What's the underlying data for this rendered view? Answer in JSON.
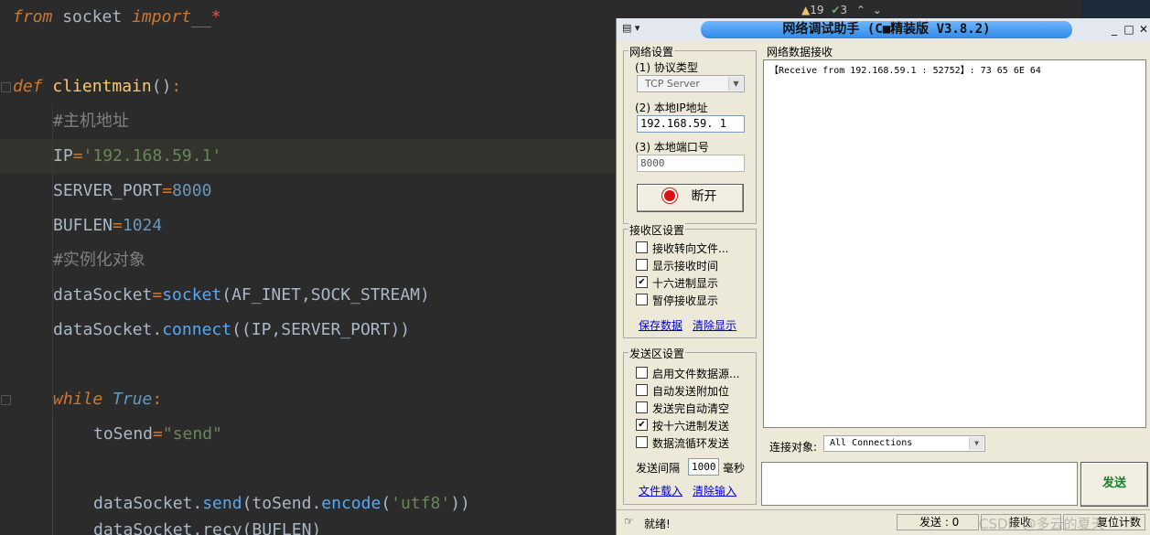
{
  "editor": {
    "line1": {
      "kw1": "from",
      "mid": " socket ",
      "kw2": "import",
      "space": "  ",
      "star": "*"
    },
    "line_def": {
      "kw": "def",
      "name": "clientmain",
      "paren": "()",
      "colon": ":"
    },
    "comment1": "#主机地址",
    "ip_line": {
      "name": "IP",
      "eq": "=",
      "value": "'192.168.59.1'"
    },
    "port_line": {
      "name": "SERVER_PORT",
      "eq": "=",
      "value": "8000"
    },
    "buflen_line": {
      "name": "BUFLEN",
      "eq": "=",
      "value": "1024"
    },
    "comment2": "#实例化对象",
    "socket_line": {
      "name": "dataSocket",
      "eq": "=",
      "call": "socket",
      "args": "(AF_INET,SOCK_STREAM)"
    },
    "connect_line": {
      "obj": "dataSocket",
      "dot": ".",
      "call": "connect",
      "args": "((IP,SERVER_PORT))"
    },
    "while_line": {
      "kw": "while",
      "val": "True",
      "colon": ":"
    },
    "tosend_line": {
      "name": "toSend",
      "eq": "=",
      "value": "\"send\""
    },
    "send_line": {
      "obj": "dataSocket",
      "dot": ".",
      "call": "send",
      "p1": "(toSend",
      "dot2": ".",
      "call2": "encode",
      "p2": "(",
      "str": "'utf8'",
      "p3": "))"
    },
    "recv_partial": "dataSocket.recv(BUFLEN)",
    "indicators": {
      "warnings": "19",
      "checks": "3"
    }
  },
  "window": {
    "title": "网络调试助手 (C■精装版 V3.8.2)",
    "sysmenu": "▾",
    "min": "_",
    "max": "□",
    "close": "✕",
    "net": {
      "legend": "网络设置",
      "proto_label": "(1) 协议类型",
      "proto_value": "TCP Server",
      "ip_label": "(2) 本地IP地址",
      "ip_value": "192.168.59. 1",
      "port_label": "(3) 本地端口号",
      "port_value": "8000",
      "disconnect": "断开"
    },
    "recv": {
      "legend": "接收区设置",
      "opts": [
        {
          "label": "接收转向文件...",
          "checked": false
        },
        {
          "label": "显示接收时间",
          "checked": false
        },
        {
          "label": "十六进制显示",
          "checked": true
        },
        {
          "label": "暂停接收显示",
          "checked": false
        }
      ],
      "save": "保存数据",
      "clear": "清除显示"
    },
    "send": {
      "legend": "发送区设置",
      "opts": [
        {
          "label": "启用文件数据源...",
          "checked": false
        },
        {
          "label": "自动发送附加位",
          "checked": false
        },
        {
          "label": "发送完自动清空",
          "checked": false
        },
        {
          "label": "按十六进制发送",
          "checked": true
        },
        {
          "label": "数据流循环发送",
          "checked": false
        }
      ],
      "interval_label": "发送间隔",
      "interval_value": "1000",
      "interval_unit": "毫秒",
      "load": "文件载入",
      "clear_input": "清除输入"
    },
    "data_recv": {
      "legend": "网络数据接收",
      "text": "【Receive from 192.168.59.1 : 52752】: 73 65 6E 64"
    },
    "conn": {
      "label": "连接对象:",
      "value": "All Connections"
    },
    "send_button": "发送",
    "status": {
      "ready": "就绪!",
      "sent": "发送 : 0",
      "recv": "接收",
      "watermark": "CSDN @多云的夏天",
      "reset": "复位计数"
    }
  }
}
